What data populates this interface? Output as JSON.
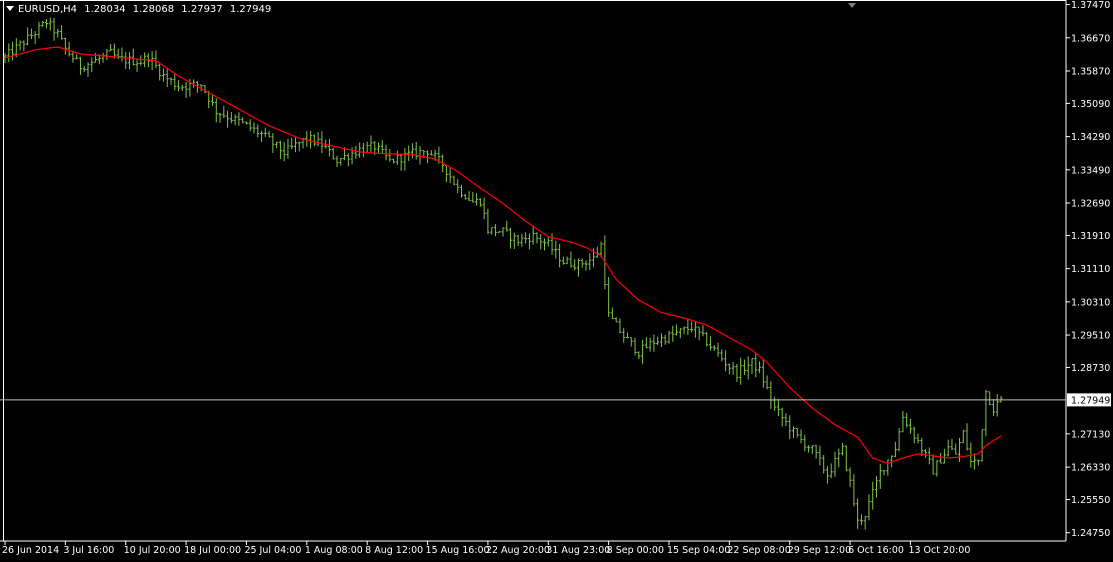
{
  "header": {
    "symbol": "EURUSD,H4",
    "open": "1.28034",
    "high": "1.28068",
    "low": "1.27937",
    "close": "1.27949"
  },
  "colors": {
    "background": "#000000",
    "bars": "#7fc44a",
    "moving_average": "#ff0000",
    "price_line": "#c0c0c0",
    "axis": "#ffffff"
  },
  "chart_data": {
    "type": "bar",
    "bar_style": "ohlc",
    "grid": false,
    "current_price": 1.27949,
    "ylim": [
      1.2455,
      1.3758
    ],
    "y_ticks": [
      "1.37470",
      "1.36670",
      "1.35870",
      "1.35090",
      "1.34290",
      "1.33490",
      "1.32690",
      "1.31910",
      "1.31110",
      "1.30310",
      "1.29510",
      "1.28730",
      "1.27130",
      "1.26330",
      "1.25550",
      "1.24750"
    ],
    "x_ticks": [
      "26 Jun 2014",
      "3 Jul 16:00",
      "10 Jul 20:00",
      "18 Jul 00:00",
      "25 Jul 04:00",
      "1 Aug 08:00",
      "8 Aug 12:00",
      "15 Aug 16:00",
      "22 Aug 20:00",
      "31 Aug 23:00",
      "8 Sep 00:00",
      "15 Sep 04:00",
      "22 Sep 08:00",
      "29 Sep 12:00",
      "6 Oct 16:00",
      "13 Oct 20:00"
    ],
    "x_tick_index": [
      0,
      16,
      32,
      48,
      64,
      80,
      96,
      112,
      128,
      144,
      160,
      176,
      192,
      208,
      224,
      240
    ],
    "price_path": [
      [
        0,
        1.362
      ],
      [
        4,
        1.365
      ],
      [
        8,
        1.368
      ],
      [
        11,
        1.3705
      ],
      [
        14,
        1.3675
      ],
      [
        16,
        1.364
      ],
      [
        20,
        1.3598
      ],
      [
        24,
        1.3612
      ],
      [
        28,
        1.363
      ],
      [
        30,
        1.3615
      ],
      [
        36,
        1.361
      ],
      [
        38,
        1.3622
      ],
      [
        42,
        1.3575
      ],
      [
        46,
        1.355
      ],
      [
        52,
        1.3555
      ],
      [
        56,
        1.349
      ],
      [
        62,
        1.3465
      ],
      [
        68,
        1.3435
      ],
      [
        74,
        1.339
      ],
      [
        80,
        1.3425
      ],
      [
        84,
        1.341
      ],
      [
        88,
        1.3372
      ],
      [
        94,
        1.3398
      ],
      [
        98,
        1.3405
      ],
      [
        102,
        1.337
      ],
      [
        108,
        1.3388
      ],
      [
        112,
        1.3395
      ],
      [
        116,
        1.3362
      ],
      [
        120,
        1.3305
      ],
      [
        124,
        1.3272
      ],
      [
        126,
        1.3275
      ],
      [
        128,
        1.3205
      ],
      [
        132,
        1.32
      ],
      [
        136,
        1.3178
      ],
      [
        140,
        1.319
      ],
      [
        144,
        1.3168
      ],
      [
        148,
        1.3128
      ],
      [
        152,
        1.3122
      ],
      [
        156,
        1.3135
      ],
      [
        158,
        1.3168
      ],
      [
        160,
        1.2998
      ],
      [
        164,
        1.2948
      ],
      [
        168,
        1.291
      ],
      [
        172,
        1.2935
      ],
      [
        178,
        1.2955
      ],
      [
        182,
        1.297
      ],
      [
        186,
        1.2935
      ],
      [
        188,
        1.2915
      ],
      [
        192,
        1.2875
      ],
      [
        194,
        1.286
      ],
      [
        198,
        1.2885
      ],
      [
        200,
        1.2865
      ],
      [
        204,
        1.2775
      ],
      [
        210,
        1.2705
      ],
      [
        214,
        1.2675
      ],
      [
        218,
        1.2615
      ],
      [
        222,
        1.2675
      ],
      [
        224,
        1.2595
      ],
      [
        226,
        1.25
      ],
      [
        228,
        1.252
      ],
      [
        232,
        1.262
      ],
      [
        236,
        1.268
      ],
      [
        238,
        1.2755
      ],
      [
        242,
        1.2695
      ],
      [
        246,
        1.2625
      ],
      [
        250,
        1.268
      ],
      [
        252,
        1.2665
      ],
      [
        254,
        1.2715
      ],
      [
        256,
        1.2645
      ],
      [
        258,
        1.2648
      ],
      [
        260,
        1.2815
      ],
      [
        262,
        1.2775
      ],
      [
        264,
        1.2795
      ]
    ],
    "ma_path": [
      [
        0,
        1.3618
      ],
      [
        8,
        1.3638
      ],
      [
        14,
        1.3645
      ],
      [
        20,
        1.3628
      ],
      [
        28,
        1.3622
      ],
      [
        36,
        1.3615
      ],
      [
        40,
        1.3612
      ],
      [
        46,
        1.3575
      ],
      [
        54,
        1.3535
      ],
      [
        62,
        1.3495
      ],
      [
        70,
        1.3455
      ],
      [
        78,
        1.3425
      ],
      [
        86,
        1.3408
      ],
      [
        94,
        1.3392
      ],
      [
        100,
        1.3388
      ],
      [
        108,
        1.3386
      ],
      [
        114,
        1.3375
      ],
      [
        120,
        1.3345
      ],
      [
        126,
        1.3305
      ],
      [
        132,
        1.3268
      ],
      [
        138,
        1.3225
      ],
      [
        144,
        1.3188
      ],
      [
        150,
        1.3175
      ],
      [
        154,
        1.3162
      ],
      [
        158,
        1.3142
      ],
      [
        162,
        1.3085
      ],
      [
        168,
        1.3035
      ],
      [
        174,
        1.3005
      ],
      [
        180,
        1.2992
      ],
      [
        186,
        1.2975
      ],
      [
        192,
        1.2945
      ],
      [
        198,
        1.2915
      ],
      [
        202,
        1.2885
      ],
      [
        208,
        1.2825
      ],
      [
        214,
        1.2775
      ],
      [
        220,
        1.2735
      ],
      [
        226,
        1.2705
      ],
      [
        230,
        1.2655
      ],
      [
        234,
        1.2642
      ],
      [
        238,
        1.2655
      ],
      [
        242,
        1.2665
      ],
      [
        246,
        1.266
      ],
      [
        250,
        1.2655
      ],
      [
        254,
        1.2658
      ],
      [
        258,
        1.2665
      ],
      [
        260,
        1.2685
      ],
      [
        264,
        1.2708
      ]
    ]
  }
}
